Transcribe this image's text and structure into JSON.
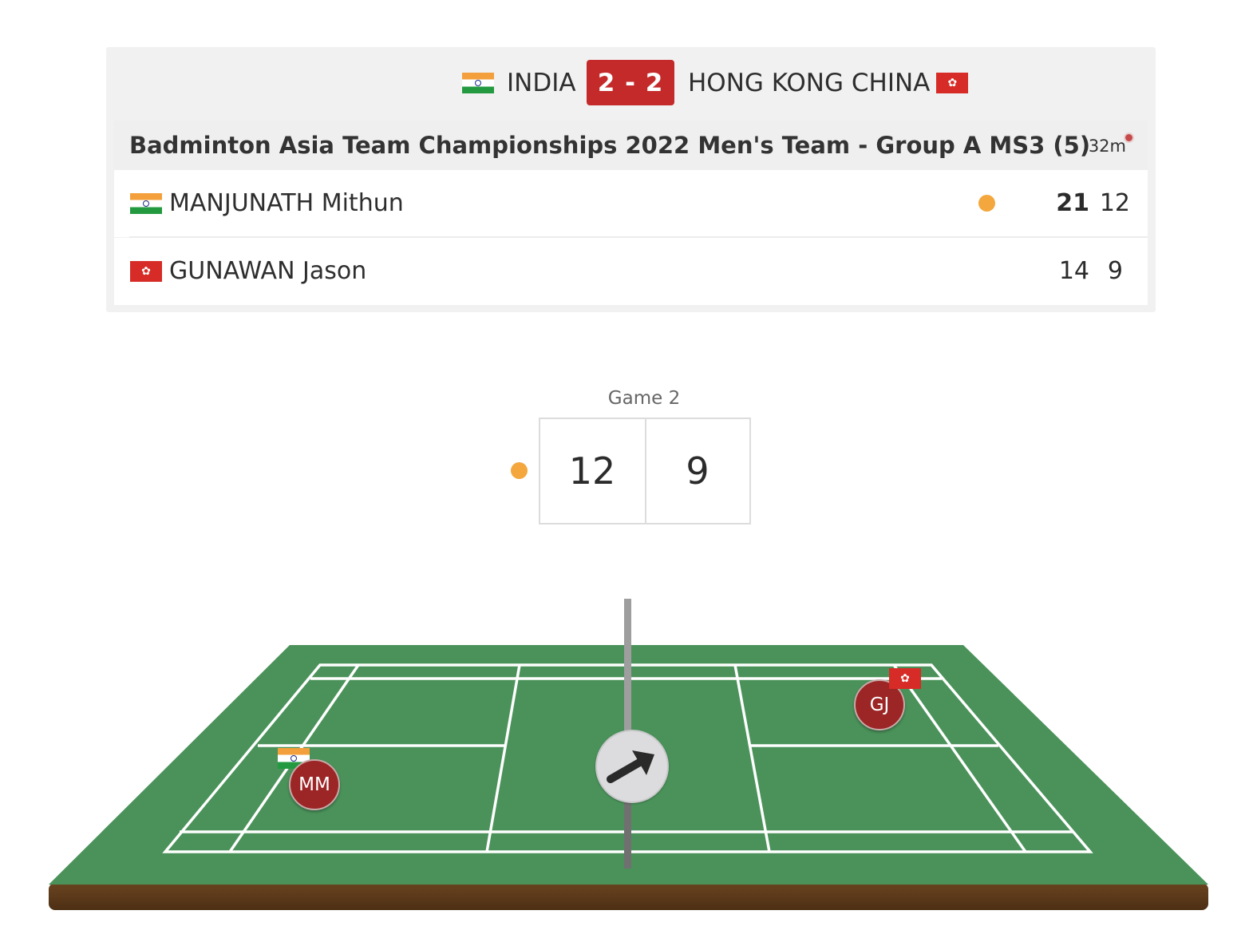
{
  "match_header": {
    "home_team": "INDIA",
    "away_team": "HONG KONG CHINA",
    "team_score": "2 - 2",
    "home_flag_icon": "india-flag-icon",
    "away_flag_icon": "hong-kong-flag-icon"
  },
  "match": {
    "title": "Badminton Asia Team Championships 2022 Men's Team - Group A MS3 (5)",
    "duration": "32m",
    "players": [
      {
        "name": "MANJUNATH Mithun",
        "flag_icon": "india-flag-icon",
        "serving": true,
        "game1": "21",
        "game2": "12"
      },
      {
        "name": "GUNAWAN Jason",
        "flag_icon": "hong-kong-flag-icon",
        "serving": false,
        "game1": "14",
        "game2": "9"
      }
    ]
  },
  "current_game": {
    "label": "Game 2",
    "home_score": "12",
    "away_score": "9"
  },
  "court": {
    "home_token": "MM",
    "away_token": "GJ",
    "shuttle_button_icon": "arrow-up-right-icon",
    "colors": {
      "surface": "#4a925a",
      "base": "#5b3a1c",
      "lines": "#ffffff",
      "token": "#9c2525",
      "serve_indicator": "#f3a73c",
      "score_badge": "#c42a2a"
    }
  }
}
